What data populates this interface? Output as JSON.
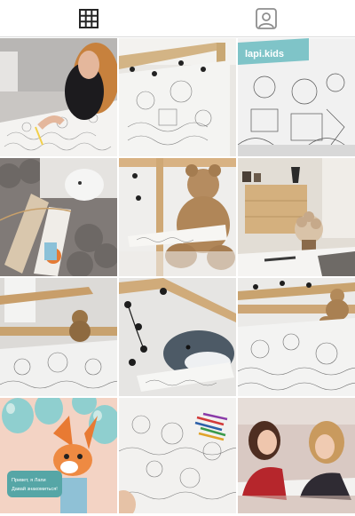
{
  "tabs": [
    {
      "name": "tab-grid",
      "icon": "grid-icon",
      "active": true
    },
    {
      "name": "tab-tagged",
      "icon": "tagged-user-icon",
      "active": false
    }
  ],
  "posts": [
    {
      "id": 1,
      "subject": "woman coloring large poster"
    },
    {
      "id": 2,
      "subject": "coloring poster under loft bed"
    },
    {
      "id": 3,
      "subject": "lapikids coloring poster",
      "tag_text": "lapi.kids"
    },
    {
      "id": 4,
      "subject": "rolled posters on knit blanket"
    },
    {
      "id": 5,
      "subject": "teddy bear with rolled poster"
    },
    {
      "id": 6,
      "subject": "room with dresser and flowers"
    },
    {
      "id": 7,
      "subject": "teddy bear by window with poster"
    },
    {
      "id": 8,
      "subject": "stuffed shark with poster"
    },
    {
      "id": 9,
      "subject": "teddy bear on loft bed ledge"
    },
    {
      "id": 10,
      "subject": "fox mascot with balloons",
      "speech_line1": "Привет, я Лапи",
      "speech_line2": "Давай знакомиться!"
    },
    {
      "id": 11,
      "subject": "coloring poster with markers"
    },
    {
      "id": 12,
      "subject": "two women coloring on floor"
    }
  ],
  "colors": {
    "active_tab": "#262626",
    "inactive_tab": "#8e8e8e",
    "divider": "#dbdbdb",
    "teal": "#7fc4c8"
  }
}
